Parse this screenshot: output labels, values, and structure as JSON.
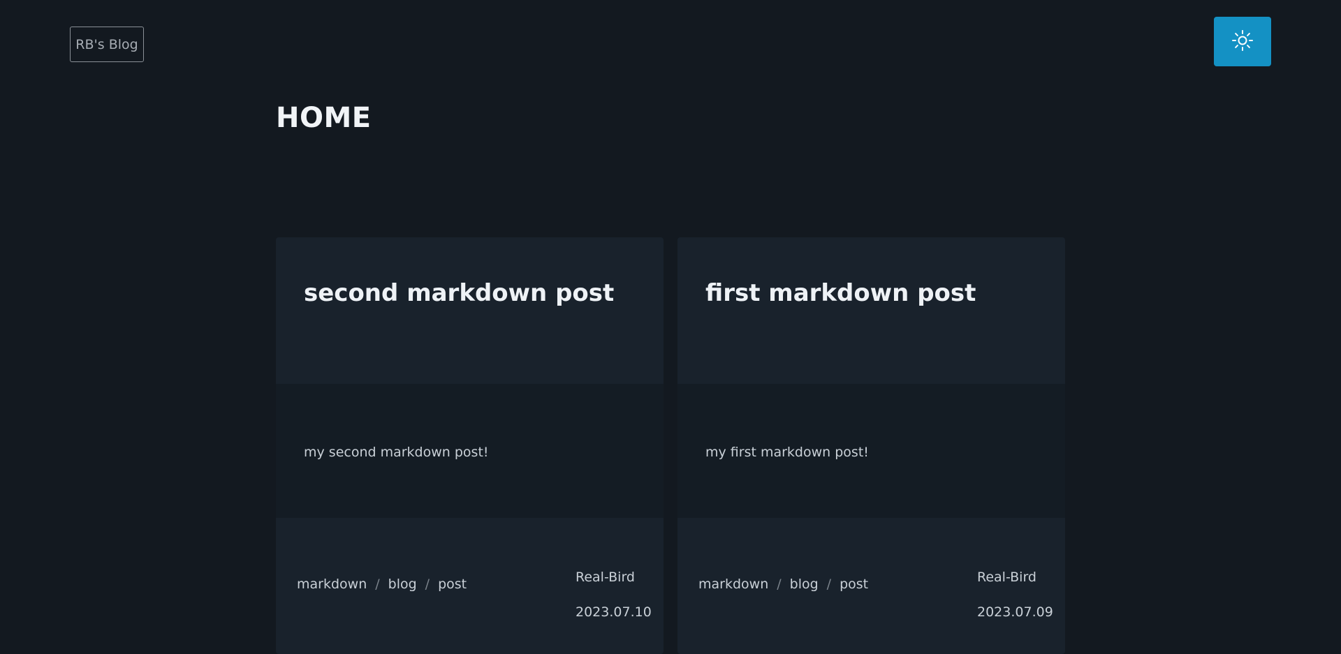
{
  "header": {
    "logo_text": "RB's Blog",
    "theme_toggle_icon": "sun-icon",
    "accent_color": "#1491c4"
  },
  "main": {
    "title": "HOME",
    "posts": [
      {
        "title": "second markdown post",
        "description": "my second markdown post!",
        "tags": [
          "markdown",
          "blog",
          "post"
        ],
        "author": "Real-Bird",
        "date": "2023.07.10"
      },
      {
        "title": "first markdown post",
        "description": "my first markdown post!",
        "tags": [
          "markdown",
          "blog",
          "post"
        ],
        "author": "Real-Bird",
        "date": "2023.07.09"
      }
    ]
  },
  "tag_separator": "/"
}
